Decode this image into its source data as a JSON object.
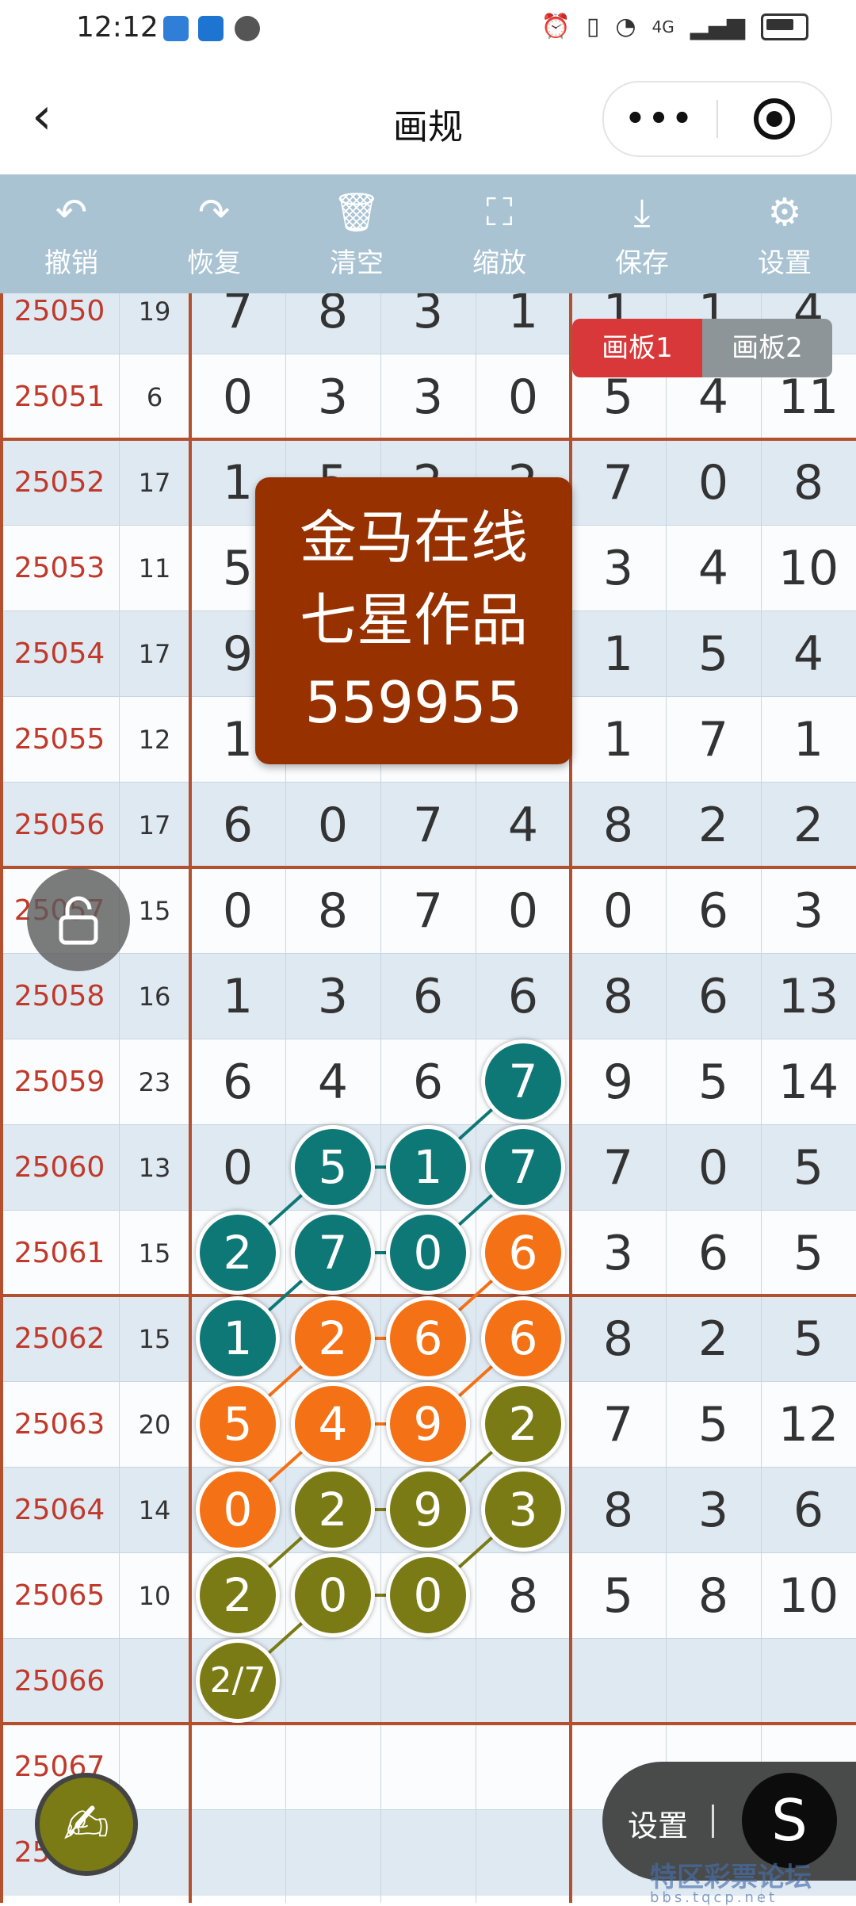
{
  "status_bar": {
    "time": "12:12",
    "network": "4G"
  },
  "nav": {
    "title": "画规",
    "back_icon": "chevron-left-icon",
    "more_icon": "more-dots-icon",
    "target_icon": "target-icon"
  },
  "toolbar": [
    {
      "label": "撤销",
      "icon": "undo-icon"
    },
    {
      "label": "恢复",
      "icon": "redo-icon"
    },
    {
      "label": "清空",
      "icon": "trash-icon"
    },
    {
      "label": "缩放",
      "icon": "zoom-icon"
    },
    {
      "label": "保存",
      "icon": "download-icon"
    },
    {
      "label": "设置",
      "icon": "gear-icon"
    }
  ],
  "board_tabs": {
    "active": "画板1",
    "inactive": "画板2"
  },
  "banner": {
    "line1": "金马在线",
    "line2": "七星作品",
    "line3": "559955"
  },
  "rows": [
    {
      "issue": "25050",
      "sum": "19",
      "nums": [
        "7",
        "8",
        "3",
        "1",
        "1",
        "1",
        "4"
      ]
    },
    {
      "issue": "25051",
      "sum": "6",
      "nums": [
        "0",
        "3",
        "3",
        "0",
        "5",
        "4",
        "11"
      ]
    },
    {
      "issue": "25052",
      "sum": "17",
      "nums": [
        "1",
        "5",
        "2",
        "2",
        "7",
        "0",
        "8"
      ]
    },
    {
      "issue": "25053",
      "sum": "11",
      "nums": [
        "5",
        "",
        "",
        "",
        "3",
        "4",
        "10"
      ]
    },
    {
      "issue": "25054",
      "sum": "17",
      "nums": [
        "9",
        "",
        "",
        "",
        "1",
        "5",
        "4"
      ]
    },
    {
      "issue": "25055",
      "sum": "12",
      "nums": [
        "1",
        "",
        "",
        "",
        "1",
        "7",
        "1"
      ]
    },
    {
      "issue": "25056",
      "sum": "17",
      "nums": [
        "6",
        "0",
        "7",
        "4",
        "8",
        "2",
        "2"
      ]
    },
    {
      "issue": "25057",
      "sum": "15",
      "nums": [
        "0",
        "8",
        "7",
        "0",
        "0",
        "6",
        "3"
      ]
    },
    {
      "issue": "25058",
      "sum": "16",
      "nums": [
        "1",
        "3",
        "6",
        "6",
        "8",
        "6",
        "13"
      ]
    },
    {
      "issue": "25059",
      "sum": "23",
      "nums": [
        "6",
        "4",
        "6",
        "7",
        "9",
        "5",
        "14"
      ]
    },
    {
      "issue": "25060",
      "sum": "13",
      "nums": [
        "0",
        "5",
        "1",
        "7",
        "7",
        "0",
        "5"
      ]
    },
    {
      "issue": "25061",
      "sum": "15",
      "nums": [
        "2",
        "7",
        "0",
        "6",
        "3",
        "6",
        "5"
      ]
    },
    {
      "issue": "25062",
      "sum": "15",
      "nums": [
        "1",
        "2",
        "6",
        "6",
        "8",
        "2",
        "5"
      ]
    },
    {
      "issue": "25063",
      "sum": "20",
      "nums": [
        "5",
        "4",
        "9",
        "2",
        "7",
        "5",
        "12"
      ]
    },
    {
      "issue": "25064",
      "sum": "14",
      "nums": [
        "0",
        "2",
        "9",
        "3",
        "8",
        "3",
        "6"
      ]
    },
    {
      "issue": "25065",
      "sum": "10",
      "nums": [
        "2",
        "0",
        "0",
        "8",
        "5",
        "8",
        "10"
      ]
    },
    {
      "issue": "25066",
      "sum": "",
      "nums": [
        "2/7",
        "",
        "",
        "",
        "",
        "",
        ""
      ]
    },
    {
      "issue": "25067",
      "sum": "",
      "nums": [
        "",
        "",
        "",
        "",
        "",
        "",
        ""
      ]
    },
    {
      "issue": "25068",
      "sum": "",
      "nums": [
        "",
        "",
        "",
        "",
        "",
        "",
        ""
      ]
    }
  ],
  "colors": {
    "teal": "#0e7877",
    "orange": "#f47115",
    "olive": "#7a7b14",
    "issue_red": "#c0392b",
    "banner": "#973200",
    "toolbar": "#a9c3d3"
  },
  "marks": [
    {
      "row": 9,
      "col": 3,
      "color": "teal"
    },
    {
      "row": 10,
      "col": 1,
      "color": "teal"
    },
    {
      "row": 10,
      "col": 2,
      "color": "teal"
    },
    {
      "row": 10,
      "col": 3,
      "color": "teal"
    },
    {
      "row": 11,
      "col": 0,
      "color": "teal"
    },
    {
      "row": 11,
      "col": 1,
      "color": "teal"
    },
    {
      "row": 11,
      "col": 2,
      "color": "teal"
    },
    {
      "row": 11,
      "col": 3,
      "color": "orange"
    },
    {
      "row": 12,
      "col": 0,
      "color": "teal"
    },
    {
      "row": 12,
      "col": 1,
      "color": "orange"
    },
    {
      "row": 12,
      "col": 2,
      "color": "orange"
    },
    {
      "row": 12,
      "col": 3,
      "color": "orange"
    },
    {
      "row": 13,
      "col": 0,
      "color": "orange"
    },
    {
      "row": 13,
      "col": 1,
      "color": "orange"
    },
    {
      "row": 13,
      "col": 2,
      "color": "orange"
    },
    {
      "row": 13,
      "col": 3,
      "color": "olive"
    },
    {
      "row": 14,
      "col": 0,
      "color": "orange"
    },
    {
      "row": 14,
      "col": 1,
      "color": "olive"
    },
    {
      "row": 14,
      "col": 2,
      "color": "olive"
    },
    {
      "row": 14,
      "col": 3,
      "color": "olive"
    },
    {
      "row": 15,
      "col": 0,
      "color": "olive"
    },
    {
      "row": 15,
      "col": 1,
      "color": "olive"
    },
    {
      "row": 15,
      "col": 2,
      "color": "olive"
    },
    {
      "row": 16,
      "col": 0,
      "color": "olive"
    }
  ],
  "links": [
    {
      "color": "teal",
      "from": [
        9,
        3
      ],
      "to": [
        10,
        2
      ]
    },
    {
      "color": "teal",
      "from": [
        10,
        1
      ],
      "to": [
        10,
        2
      ]
    },
    {
      "color": "teal",
      "from": [
        10,
        3
      ],
      "to": [
        11,
        2
      ]
    },
    {
      "color": "teal",
      "from": [
        10,
        1
      ],
      "to": [
        11,
        0
      ]
    },
    {
      "color": "teal",
      "from": [
        11,
        1
      ],
      "to": [
        11,
        2
      ]
    },
    {
      "color": "teal",
      "from": [
        11,
        1
      ],
      "to": [
        12,
        0
      ]
    },
    {
      "color": "orange",
      "from": [
        11,
        3
      ],
      "to": [
        12,
        2
      ]
    },
    {
      "color": "orange",
      "from": [
        12,
        1
      ],
      "to": [
        12,
        2
      ]
    },
    {
      "color": "orange",
      "from": [
        12,
        1
      ],
      "to": [
        13,
        0
      ]
    },
    {
      "color": "orange",
      "from": [
        12,
        3
      ],
      "to": [
        13,
        2
      ]
    },
    {
      "color": "orange",
      "from": [
        13,
        1
      ],
      "to": [
        13,
        2
      ]
    },
    {
      "color": "orange",
      "from": [
        13,
        1
      ],
      "to": [
        14,
        0
      ]
    },
    {
      "color": "olive",
      "from": [
        13,
        3
      ],
      "to": [
        14,
        2
      ]
    },
    {
      "color": "olive",
      "from": [
        14,
        1
      ],
      "to": [
        14,
        2
      ]
    },
    {
      "color": "olive",
      "from": [
        14,
        1
      ],
      "to": [
        15,
        0
      ]
    },
    {
      "color": "olive",
      "from": [
        14,
        3
      ],
      "to": [
        15,
        2
      ]
    },
    {
      "color": "olive",
      "from": [
        15,
        1
      ],
      "to": [
        15,
        2
      ]
    },
    {
      "color": "olive",
      "from": [
        15,
        1
      ],
      "to": [
        16,
        0
      ]
    }
  ],
  "floating": {
    "settings_label": "设置",
    "s_button": "S",
    "pen_icon": "pen-icon",
    "lock_icon": "lock-icon"
  },
  "watermark": {
    "text": "特区彩票论坛",
    "sub": "bbs.tqcp.net"
  }
}
